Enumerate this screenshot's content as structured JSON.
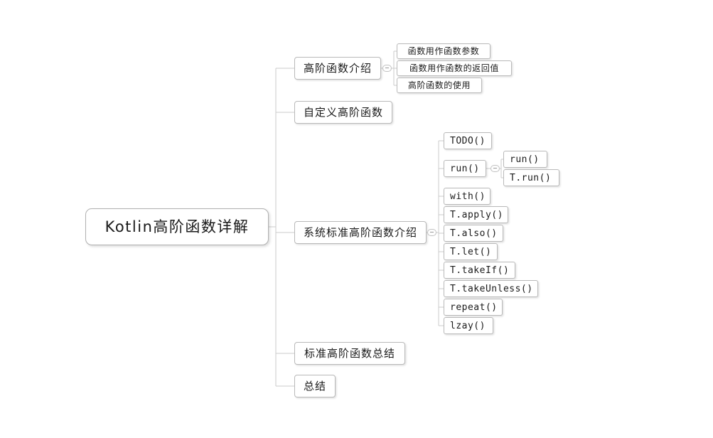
{
  "diagram": {
    "type": "mindmap",
    "title": "Kotlin高阶函数详解",
    "colors": {
      "background": "#ffffff",
      "node_border": "#b9b9b9",
      "node_fill": "#ffffff",
      "edge": "#c9c9c9",
      "text": "#1a1a1a"
    }
  },
  "root": {
    "label": "Kotlin高阶函数详解"
  },
  "branches": [
    {
      "id": "intro",
      "label": "高阶函数介绍",
      "collapse_toggle": "expanded",
      "children": [
        {
          "id": "arg",
          "label": "函数用作函数参数"
        },
        {
          "id": "ret",
          "label": "函数用作函数的返回值"
        },
        {
          "id": "use",
          "label": "高阶函数的使用"
        }
      ]
    },
    {
      "id": "custom",
      "label": "自定义高阶函数",
      "children": []
    },
    {
      "id": "std",
      "label": "系统标准高阶函数介绍",
      "collapse_toggle": "expanded",
      "children": [
        {
          "id": "todo",
          "label": "TODO()"
        },
        {
          "id": "run",
          "label": "run()",
          "collapse_toggle": "expanded",
          "children": [
            {
              "id": "run_plain",
              "label": "run()"
            },
            {
              "id": "run_t",
              "label": "T.run()"
            }
          ]
        },
        {
          "id": "with",
          "label": "with()"
        },
        {
          "id": "apply",
          "label": "T.apply()"
        },
        {
          "id": "also",
          "label": "T.also()"
        },
        {
          "id": "let",
          "label": "T.let()"
        },
        {
          "id": "takeif",
          "label": "T.takeIf()"
        },
        {
          "id": "takeunless",
          "label": "T.takeUnless()"
        },
        {
          "id": "repeat",
          "label": "repeat()"
        },
        {
          "id": "lzay",
          "label": "lzay()"
        }
      ]
    },
    {
      "id": "summary",
      "label": "标准高阶函数总结",
      "children": []
    },
    {
      "id": "end",
      "label": "总结",
      "children": []
    }
  ]
}
